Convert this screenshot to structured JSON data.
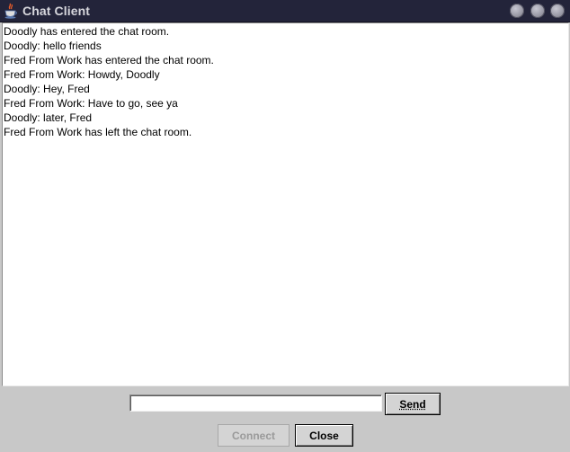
{
  "window": {
    "title": "Chat Client",
    "icon": "java-cup-icon",
    "controls": [
      "minimize-icon",
      "maximize-icon",
      "close-icon"
    ]
  },
  "chat": {
    "messages": [
      "Doodly has entered the chat room.",
      "Doodly: hello friends",
      "Fred From Work has entered the chat room.",
      "Fred From Work: Howdy, Doodly",
      "Doodly: Hey, Fred",
      "Fred From Work: Have to go, see ya",
      "Doodly: later, Fred",
      "Fred From Work has left the chat room."
    ]
  },
  "composer": {
    "input_value": "",
    "send_label": "Send"
  },
  "footer": {
    "connect_label": "Connect",
    "connect_enabled": false,
    "close_label": "Close"
  }
}
